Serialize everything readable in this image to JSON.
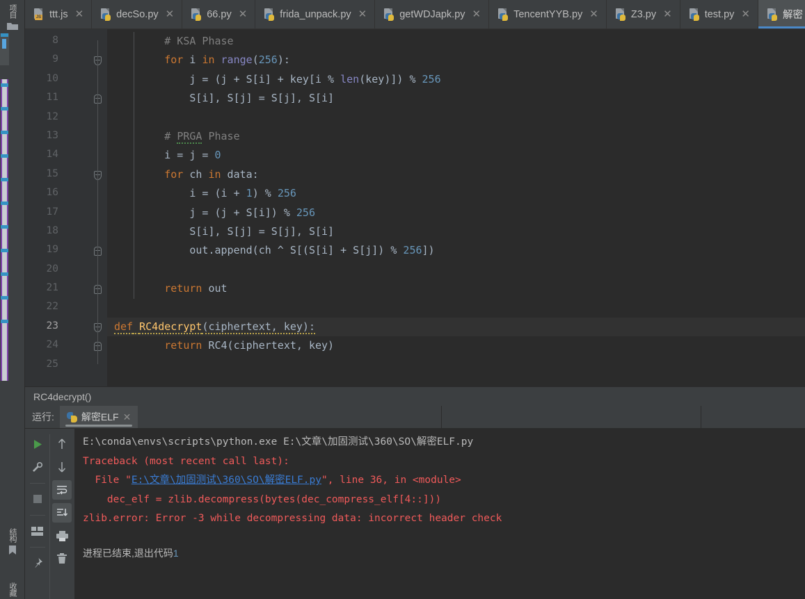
{
  "window": {
    "theme_bg": "#3c3f41",
    "editor_bg": "#2b2b2b",
    "accent": "#4a88c7"
  },
  "toolstrip": {
    "project_label": "项目",
    "project_icon": "folder-icon",
    "structure_label": "结构",
    "structure_icon": "bookmark-icon",
    "favorites_label": "收藏"
  },
  "tabs": [
    {
      "label": "ttt.js",
      "icon": "js-file-icon",
      "close": "✕",
      "active": false
    },
    {
      "label": "decSo.py",
      "icon": "python-file-icon",
      "close": "✕",
      "active": false
    },
    {
      "label": "66.py",
      "icon": "python-file-icon",
      "close": "✕",
      "active": false
    },
    {
      "label": "frida_unpack.py",
      "icon": "python-file-icon",
      "close": "✕",
      "active": false
    },
    {
      "label": "getWDJapk.py",
      "icon": "python-file-icon",
      "close": "✕",
      "active": false
    },
    {
      "label": "TencentYYB.py",
      "icon": "python-file-icon",
      "close": "✕",
      "active": false
    },
    {
      "label": "Z3.py",
      "icon": "python-file-icon",
      "close": "✕",
      "active": false
    },
    {
      "label": "test.py",
      "icon": "python-file-icon",
      "close": "✕",
      "active": false
    },
    {
      "label": "解密",
      "icon": "python-file-icon",
      "close": "",
      "active": true
    }
  ],
  "editor": {
    "lines": [
      {
        "n": "8",
        "indent_guide": false,
        "fold": "",
        "current": false,
        "tokens": [
          {
            "t": "        ",
            "c": "txt"
          },
          {
            "t": "# KSA Phase",
            "c": "cm"
          }
        ]
      },
      {
        "n": "9",
        "indent_guide": true,
        "fold": "collapse",
        "current": false,
        "tokens": [
          {
            "t": "        ",
            "c": "txt"
          },
          {
            "t": "for",
            "c": "kw"
          },
          {
            "t": " i ",
            "c": "txt"
          },
          {
            "t": "in",
            "c": "kw"
          },
          {
            "t": " ",
            "c": "txt"
          },
          {
            "t": "range",
            "c": "fn"
          },
          {
            "t": "(",
            "c": "txt"
          },
          {
            "t": "256",
            "c": "num"
          },
          {
            "t": "):",
            "c": "txt"
          }
        ]
      },
      {
        "n": "10",
        "indent_guide": true,
        "fold": "",
        "current": false,
        "tokens": [
          {
            "t": "            j = (j + S[i] + key[i % ",
            "c": "txt"
          },
          {
            "t": "len",
            "c": "fn"
          },
          {
            "t": "(key)]) % ",
            "c": "txt"
          },
          {
            "t": "256",
            "c": "num"
          }
        ]
      },
      {
        "n": "11",
        "indent_guide": true,
        "fold": "end",
        "current": false,
        "tokens": [
          {
            "t": "            S[i], S[j] = S[j], S[i]",
            "c": "txt"
          }
        ]
      },
      {
        "n": "12",
        "indent_guide": true,
        "fold": "",
        "current": false,
        "tokens": []
      },
      {
        "n": "13",
        "indent_guide": true,
        "fold": "",
        "current": false,
        "tokens": [
          {
            "t": "        ",
            "c": "txt"
          },
          {
            "t": "# ",
            "c": "cm"
          },
          {
            "t": "PRGA",
            "c": "cm typo"
          },
          {
            "t": " Phase",
            "c": "cm"
          }
        ]
      },
      {
        "n": "14",
        "indent_guide": true,
        "fold": "",
        "current": false,
        "tokens": [
          {
            "t": "        i = j = ",
            "c": "txt"
          },
          {
            "t": "0",
            "c": "num"
          }
        ]
      },
      {
        "n": "15",
        "indent_guide": true,
        "fold": "collapse",
        "current": false,
        "tokens": [
          {
            "t": "        ",
            "c": "txt"
          },
          {
            "t": "for",
            "c": "kw"
          },
          {
            "t": " ch ",
            "c": "txt"
          },
          {
            "t": "in",
            "c": "kw"
          },
          {
            "t": " data:",
            "c": "txt"
          }
        ]
      },
      {
        "n": "16",
        "indent_guide": true,
        "fold": "",
        "current": false,
        "tokens": [
          {
            "t": "            i = (i + ",
            "c": "txt"
          },
          {
            "t": "1",
            "c": "num"
          },
          {
            "t": ") % ",
            "c": "txt"
          },
          {
            "t": "256",
            "c": "num"
          }
        ]
      },
      {
        "n": "17",
        "indent_guide": true,
        "fold": "",
        "current": false,
        "tokens": [
          {
            "t": "            j = (j + S[i]) % ",
            "c": "txt"
          },
          {
            "t": "256",
            "c": "num"
          }
        ]
      },
      {
        "n": "18",
        "indent_guide": true,
        "fold": "",
        "current": false,
        "tokens": [
          {
            "t": "            S[i], S[j] = S[j], S[i]",
            "c": "txt"
          }
        ]
      },
      {
        "n": "19",
        "indent_guide": true,
        "fold": "end",
        "current": false,
        "tokens": [
          {
            "t": "            out.append(ch ^ S[(S[i] + S[j]) % ",
            "c": "txt"
          },
          {
            "t": "256",
            "c": "num"
          },
          {
            "t": "])",
            "c": "txt"
          }
        ]
      },
      {
        "n": "20",
        "indent_guide": true,
        "fold": "",
        "current": false,
        "tokens": []
      },
      {
        "n": "21",
        "indent_guide": true,
        "fold": "end",
        "current": false,
        "tokens": [
          {
            "t": "        ",
            "c": "txt"
          },
          {
            "t": "return",
            "c": "kw"
          },
          {
            "t": " out",
            "c": "txt"
          }
        ]
      },
      {
        "n": "22",
        "indent_guide": false,
        "fold": "",
        "current": false,
        "tokens": []
      },
      {
        "n": "23",
        "indent_guide": false,
        "fold": "collapse",
        "current": true,
        "tokens": [
          {
            "t": "def",
            "c": "kw sq-warn"
          },
          {
            "t": " ",
            "c": "txt sq-warn"
          },
          {
            "t": "RC4decrypt",
            "c": "fnd sq-warn"
          },
          {
            "t": "(ciphertext, key):",
            "c": "par sq-warn"
          }
        ]
      },
      {
        "n": "24",
        "indent_guide": true,
        "fold": "end",
        "current": false,
        "tokens": [
          {
            "t": "        ",
            "c": "txt"
          },
          {
            "t": "return",
            "c": "kw"
          },
          {
            "t": " RC4(ciphertext, key)",
            "c": "txt"
          }
        ]
      },
      {
        "n": "25",
        "indent_guide": false,
        "fold": "",
        "current": false,
        "tokens": []
      }
    ]
  },
  "breadcrumb": {
    "text": "RC4decrypt()"
  },
  "run_window": {
    "label": "运行:",
    "tab_label": "解密ELF",
    "tab_close": "✕",
    "tools_left": [
      {
        "name": "run-button",
        "icon": "play-icon"
      },
      {
        "name": "settings-button",
        "icon": "wrench-icon"
      },
      {
        "name": "stop-button",
        "icon": "stop-icon"
      },
      {
        "name": "layout-button",
        "icon": "layout-icon"
      },
      {
        "name": "pin-button",
        "icon": "pin-icon"
      }
    ],
    "tools_right": [
      {
        "name": "prev-occurrence-button",
        "icon": "arrow-up-icon"
      },
      {
        "name": "next-occurrence-button",
        "icon": "arrow-down-icon"
      },
      {
        "name": "soft-wrap-button",
        "icon": "soft-wrap-icon",
        "active": true
      },
      {
        "name": "scroll-to-end-button",
        "icon": "scroll-to-end-icon",
        "active": true
      },
      {
        "name": "print-button",
        "icon": "print-icon"
      },
      {
        "name": "clear-all-button",
        "icon": "trash-icon"
      }
    ]
  },
  "console": {
    "command": "E:\\conda\\envs\\scripts\\python.exe E:\\文章\\加固测试\\360\\SO\\解密ELF.py",
    "traceback_header": "Traceback (most recent call last):",
    "frame_prefix": "  File \"",
    "frame_link": "E:\\文章\\加固测试\\360\\SO\\解密ELF.py",
    "frame_suffix": "\", line 36, in <module>",
    "frame_code": "    dec_elf = zlib.decompress(bytes(dec_compress_elf[4::]))",
    "error_line": "zlib.error: Error -3 while decompressing data: incorrect header check",
    "exit_text": "进程已结束,退出代码",
    "exit_code": "1"
  }
}
